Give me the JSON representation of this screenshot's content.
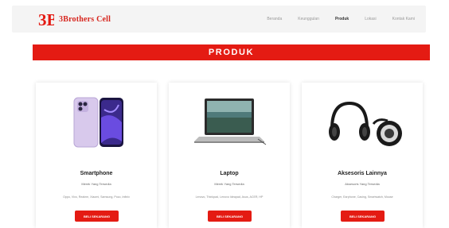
{
  "brand": {
    "name": "3Brothers Cell",
    "logo_text": "3B",
    "accent": "#e41b13"
  },
  "nav": {
    "links": [
      {
        "label": "Beranda",
        "active": false
      },
      {
        "label": "Keunggulan",
        "active": false
      },
      {
        "label": "Produk",
        "active": true
      },
      {
        "label": "Lokasi",
        "active": false
      },
      {
        "label": "Kontak Kami",
        "active": false
      }
    ]
  },
  "section": {
    "title": "PRODUK"
  },
  "products": [
    {
      "title": "Smartphone",
      "subtitle": "Merek Yang Tersedia",
      "brands": "Oppo, Vivo, Realme, Xiaomi, Samsung, Poco, Infinix",
      "button": "BELI SEKARANG",
      "icon": "smartphone-icon"
    },
    {
      "title": "Laptop",
      "subtitle": "Merek Yang Tersedia",
      "brands": "Lenovo, Thinkpad, Lenovo Ideapad, Asus, ACER, HP",
      "button": "BELI SEKARANG",
      "icon": "laptop-icon"
    },
    {
      "title": "Aksesoris Lainnya",
      "subtitle": "Aksesoris Yang Tersedia",
      "brands": "Charger, Earphone, Casing, Smartwatch, Mouse",
      "button": "BELI SEKARANG",
      "icon": "headphones-icon"
    }
  ]
}
